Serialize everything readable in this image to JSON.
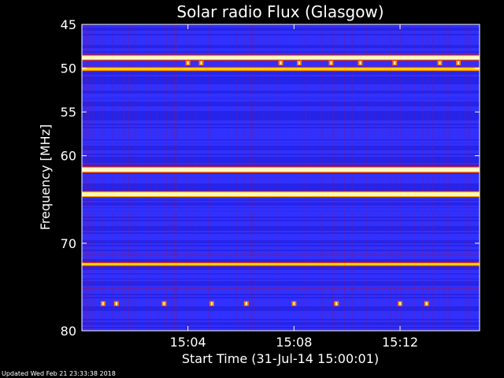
{
  "footer": {
    "updated": "Updated Wed Feb 21 23:33:38 2018"
  },
  "colors": {
    "background": "#000000",
    "text": "#ffffff",
    "colormap": [
      "#0a0a6e",
      "#1a1ad8",
      "#3232ff",
      "#7a1a8c",
      "#d81a1a",
      "#ff7a00",
      "#ffd000",
      "#fffbd0"
    ]
  },
  "chart_data": {
    "type": "heatmap",
    "title": "Solar radio Flux (Glasgow)",
    "xlabel": "Start Time (31-Jul-14 15:00:01)",
    "ylabel": "Frequency [MHz]",
    "xlim": [
      "15:00:01",
      "15:15:00"
    ],
    "ylim": [
      45,
      80
    ],
    "y_inverted": true,
    "xticks": [
      "15:04",
      "15:08",
      "15:12"
    ],
    "xtick_minutes": [
      4,
      8,
      12
    ],
    "yticks": [
      45,
      50,
      55,
      60,
      70,
      80
    ],
    "bands": [
      {
        "freq_mhz": 48.8,
        "width_mhz": 0.35,
        "intensity": 0.95
      },
      {
        "freq_mhz": 50.1,
        "width_mhz": 0.35,
        "intensity": 0.8
      },
      {
        "freq_mhz": 61.6,
        "width_mhz": 0.4,
        "intensity": 1.0
      },
      {
        "freq_mhz": 64.4,
        "width_mhz": 0.4,
        "intensity": 1.0
      },
      {
        "freq_mhz": 72.4,
        "width_mhz": 0.3,
        "intensity": 0.85
      },
      {
        "freq_mhz": 53.3,
        "width_mhz": 0.8,
        "intensity": 0.35
      },
      {
        "freq_mhz": 58.5,
        "width_mhz": 0.5,
        "intensity": 0.3
      },
      {
        "freq_mhz": 66.2,
        "width_mhz": 0.6,
        "intensity": 0.32
      },
      {
        "freq_mhz": 69.3,
        "width_mhz": 0.6,
        "intensity": 0.3
      },
      {
        "freq_mhz": 73.8,
        "width_mhz": 0.5,
        "intensity": 0.35
      }
    ],
    "bursts": [
      {
        "freq_mhz": 76.9,
        "minutes": [
          0.8,
          1.3,
          3.1,
          4.9,
          6.2,
          8.0,
          9.6,
          12.0,
          13.0
        ]
      },
      {
        "freq_mhz": 49.4,
        "minutes": [
          4.0,
          4.5,
          7.5,
          8.2,
          9.4,
          10.5,
          11.8,
          13.5,
          14.2
        ]
      }
    ]
  }
}
